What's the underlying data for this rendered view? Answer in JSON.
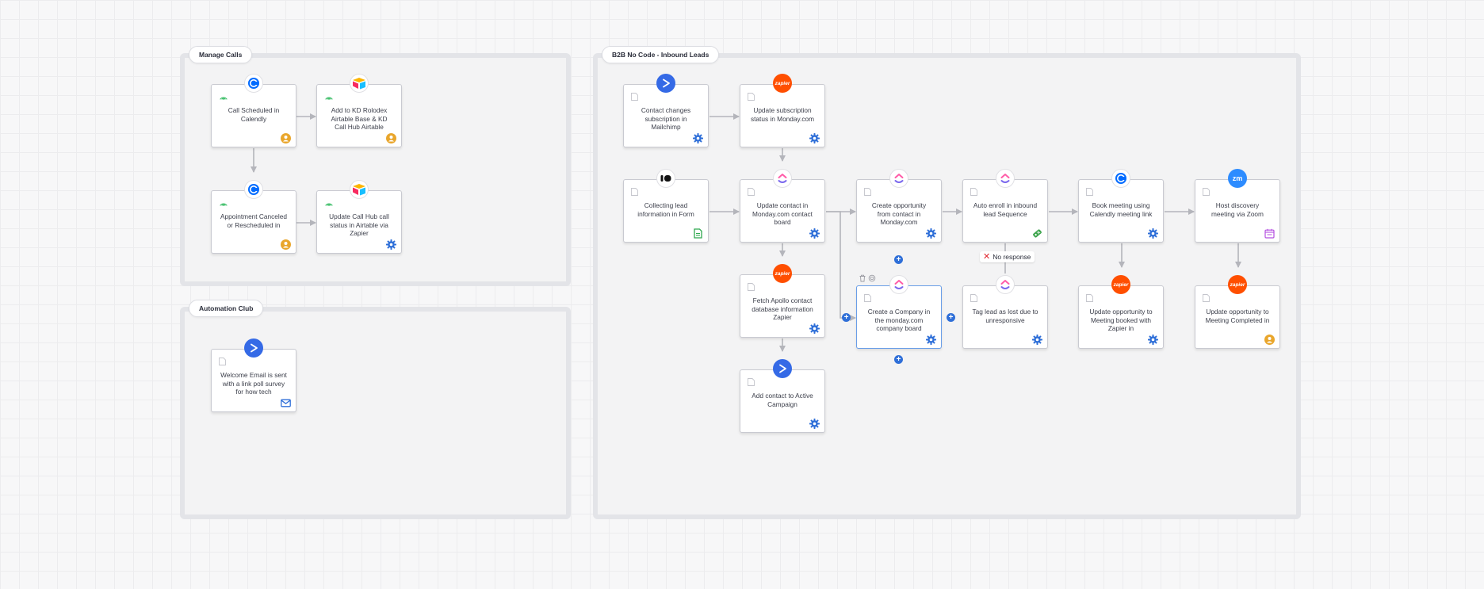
{
  "groups": {
    "manage_calls": "Manage Calls",
    "automation_club": "Automation Club",
    "b2b_inbound": "B2B No Code - Inbound Leads"
  },
  "nodes": {
    "call_scheduled": "Call Scheduled in Calendly",
    "add_to_kd_rolodex": "Add to KD Rolodex Airtable Base & KD Call Hub Airtable",
    "appointment_canceled": "Appointment Canceled or Rescheduled in",
    "update_call_hub": "Update Call Hub call status in Airtable via Zapier",
    "welcome_email": "Welcome Email is sent with a link poll survey for how tech",
    "contact_changes_subscription": "Contact changes subscription in Mailchimp",
    "update_subscription_status": "Update subscription status in Monday.com",
    "collecting_lead_info": "Collecting lead information in Form",
    "update_contact_monday": "Update contact in Monday.com contact board",
    "fetch_apollo": "Fetch Apollo contact database information Zapier",
    "add_active_campaign": "Add contact to Active Campaign",
    "create_opportunity": "Create opportunity from contact in Monday.com",
    "create_company": "Create a Company in the monday.com company board",
    "auto_enroll": "Auto enroll in inbound lead Sequence",
    "tag_lead_lost": "Tag lead as lost due to unresponsive",
    "book_meeting": "Book meeting using Calendly meeting link",
    "update_opp_booked": "Update opportunity to Meeting booked with Zapier in",
    "host_discovery": "Host discovery meeting via Zoom",
    "update_opp_completed": "Update opportunity to Meeting Completed in"
  },
  "status_tags": {
    "no_response": "No response"
  },
  "app_logos": {
    "zapier_text": "zapier",
    "zoom_text": "zm"
  },
  "colors": {
    "calendly": "#006BFF",
    "airtable_yellow": "#FCB400",
    "airtable_blue": "#18BFFF",
    "airtable_red": "#F82B60",
    "zapier": "#FF4F00",
    "active_campaign": "#356AE6",
    "zoom": "#2D8CFF",
    "plus_button": "#2F6FD8",
    "group_border": "#E3E4E8",
    "connector": "#B4B5BB"
  },
  "icons": {
    "triggers": "radio-wave-icon",
    "doc": "document-icon",
    "person": "person-badge-icon",
    "gear": "gear-icon",
    "form_badge": "form-icon",
    "mail_badge": "mail-icon",
    "tag_badge": "tag-icon",
    "calendar_badge": "calendar-icon",
    "clickup": "clickup-logo-icon",
    "typeform": "typeform-logo-icon",
    "trash": "trash-icon",
    "copy": "copy-icon"
  }
}
